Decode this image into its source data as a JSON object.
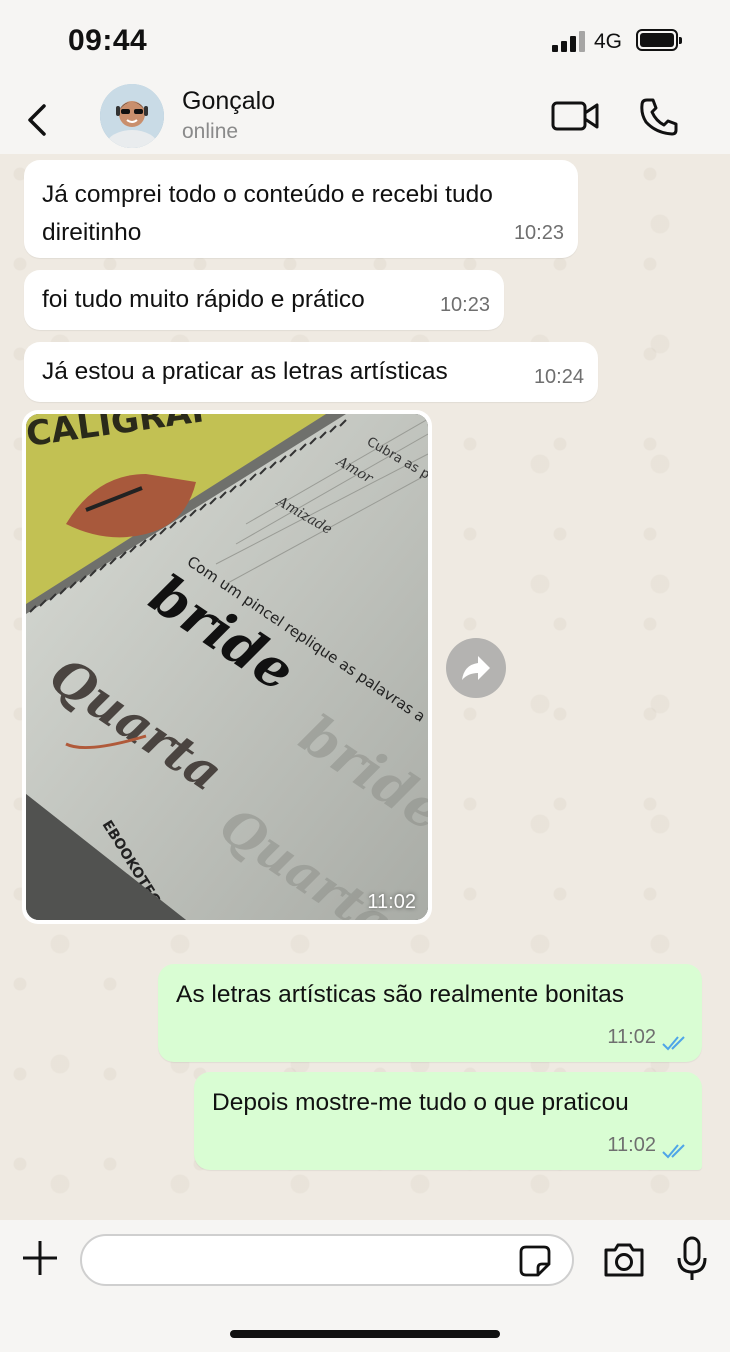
{
  "status_bar": {
    "time": "09:44",
    "network": "4G"
  },
  "header": {
    "contact_name": "Gonçalo",
    "contact_status": "online"
  },
  "messages": [
    {
      "direction": "in",
      "lines": [
        "Já comprei todo o conteúdo e recebi tudo",
        "direitinho"
      ],
      "time": "10:23"
    },
    {
      "direction": "in",
      "lines": [
        "foi tudo muito rápido e prático"
      ],
      "time": "10:23"
    },
    {
      "direction": "in",
      "lines": [
        "Já estou a praticar as letras artísticas"
      ],
      "time": "10:24"
    },
    {
      "direction": "in",
      "type": "image",
      "time": "11:02",
      "image_text": {
        "cover": "CALIGRAF",
        "instruction": "Cubra as p",
        "practice_word_1": "Amor",
        "practice_word_2": "Amizade",
        "brush_caption": "Com um pincel replique as palavras a",
        "word_bride": "bride",
        "word_quarta": "Quarta",
        "brand": "EBOOKOTECA"
      }
    },
    {
      "direction": "out",
      "lines": [
        "As letras artísticas são realmente bonitas"
      ],
      "time": "11:02",
      "status": "read"
    },
    {
      "direction": "out",
      "lines": [
        "Depois mostre-me tudo o que praticou"
      ],
      "time": "11:02",
      "status": "read"
    }
  ],
  "composer": {
    "placeholder": ""
  },
  "colors": {
    "outgoing_bubble": "#d9fdd3",
    "incoming_bubble": "#ffffff",
    "read_ticks": "#4fa5e8",
    "chat_bg": "#efeae2"
  }
}
